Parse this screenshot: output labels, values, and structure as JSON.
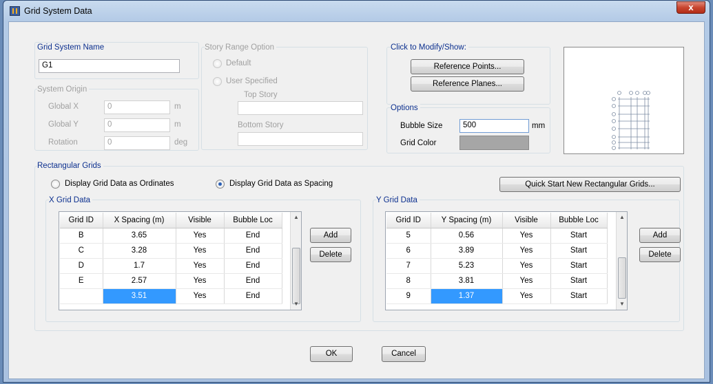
{
  "window": {
    "title": "Grid System Data",
    "close_label": "x"
  },
  "grid_system_name": {
    "label": "Grid System Name",
    "value": "G1"
  },
  "system_origin": {
    "label": "System Origin",
    "rows": [
      {
        "label": "Global X",
        "value": "0",
        "unit": "m"
      },
      {
        "label": "Global Y",
        "value": "0",
        "unit": "m"
      },
      {
        "label": "Rotation",
        "value": "0",
        "unit": "deg"
      }
    ]
  },
  "story_range": {
    "label": "Story Range Option",
    "default_label": "Default",
    "user_label": "User Specified",
    "top_story_label": "Top Story",
    "bottom_story_label": "Bottom Story",
    "top_story_value": "",
    "bottom_story_value": ""
  },
  "modify_show": {
    "label": "Click to Modify/Show:",
    "ref_points_label": "Reference Points...",
    "ref_planes_label": "Reference Planes..."
  },
  "options": {
    "label": "Options",
    "bubble_size_label": "Bubble Size",
    "bubble_size_value": "500",
    "bubble_unit": "mm",
    "grid_color_label": "Grid Color",
    "grid_color": "#a6a6a6"
  },
  "rect_grids": {
    "label": "Rectangular Grids",
    "ordinates_label": "Display Grid Data as Ordinates",
    "spacing_label": "Display Grid Data as Spacing",
    "quick_start_label": "Quick Start New Rectangular Grids..."
  },
  "x_grid": {
    "label": "X Grid Data",
    "headers": [
      "Grid ID",
      "X Spacing  (m)",
      "Visible",
      "Bubble Loc"
    ],
    "rows": [
      [
        "B",
        "3.65",
        "Yes",
        "End"
      ],
      [
        "C",
        "3.28",
        "Yes",
        "End"
      ],
      [
        "D",
        "1.7",
        "Yes",
        "End"
      ],
      [
        "E",
        "2.57",
        "Yes",
        "End"
      ],
      [
        "",
        "3.51",
        "Yes",
        "End"
      ]
    ],
    "add_label": "Add",
    "delete_label": "Delete"
  },
  "y_grid": {
    "label": "Y Grid Data",
    "headers": [
      "Grid ID",
      "Y Spacing  (m)",
      "Visible",
      "Bubble Loc"
    ],
    "rows": [
      [
        "5",
        "0.56",
        "Yes",
        "Start"
      ],
      [
        "6",
        "3.89",
        "Yes",
        "Start"
      ],
      [
        "7",
        "5.23",
        "Yes",
        "Start"
      ],
      [
        "8",
        "3.81",
        "Yes",
        "Start"
      ],
      [
        "9",
        "1.37",
        "Yes",
        "Start"
      ]
    ],
    "add_label": "Add",
    "delete_label": "Delete"
  },
  "ok_label": "OK",
  "cancel_label": "Cancel",
  "colors": {
    "selection": "#3399ff",
    "group_label": "#0b2f8e"
  }
}
